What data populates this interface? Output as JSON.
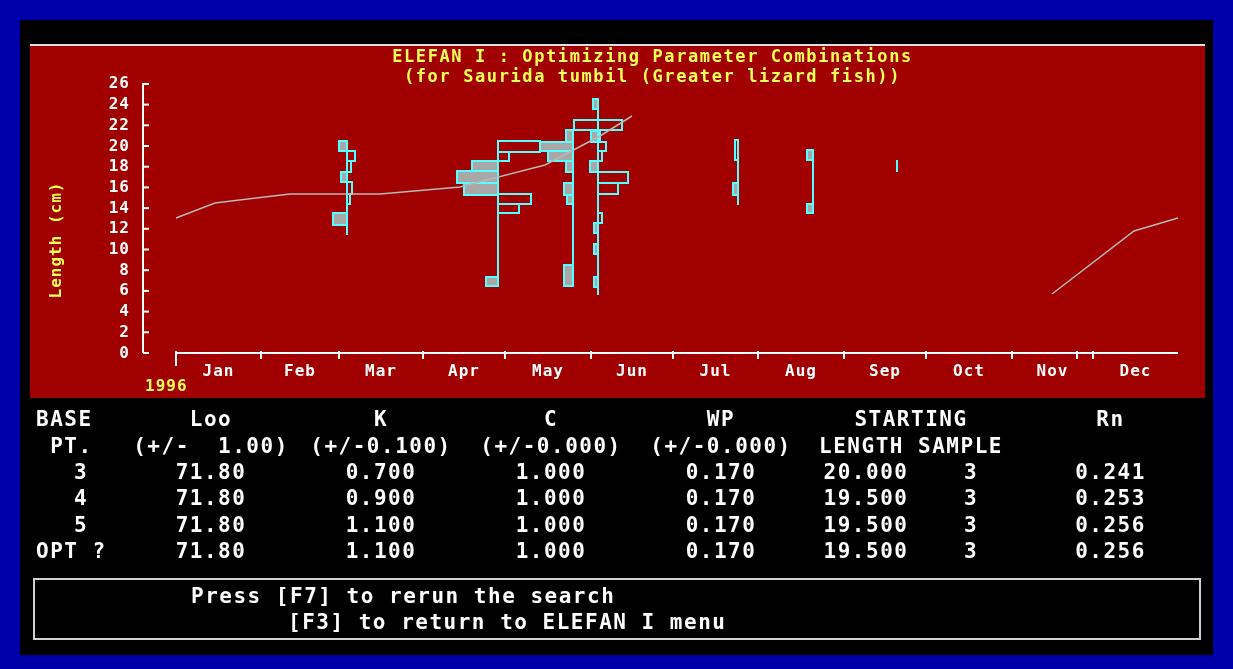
{
  "chart": {
    "title": "ELEFAN I : Optimizing Parameter Combinations",
    "subtitle": "(for Saurida tumbil (Greater lizard fish))",
    "ylabel": "Length (cm)",
    "yticks": [
      "26",
      "24",
      "22",
      "20",
      "18",
      "16",
      "14",
      "12",
      "10",
      "8",
      "6",
      "4",
      "2",
      "0"
    ],
    "months": [
      "Jan",
      "Feb",
      "Mar",
      "Apr",
      "May",
      "Jun",
      "Jul",
      "Aug",
      "Sep",
      "Oct",
      "Nov",
      "Dec"
    ],
    "year": "1996"
  },
  "table": {
    "header": [
      "BASE",
      "Loo",
      "K",
      "C",
      "WP",
      "STARTING",
      "Rn"
    ],
    "subheader": [
      "PT.",
      "(+/-  1.00)",
      "(+/-0.100)",
      "(+/-0.000)",
      "(+/-0.000)",
      "LENGTH SAMPLE"
    ],
    "rows": [
      {
        "base": "3",
        "loo": "71.80",
        "k": "0.700",
        "c": "1.000",
        "wp": "0.170",
        "length": "20.000",
        "sample": "3",
        "rn": "0.241"
      },
      {
        "base": "4",
        "loo": "71.80",
        "k": "0.900",
        "c": "1.000",
        "wp": "0.170",
        "length": "19.500",
        "sample": "3",
        "rn": "0.253"
      },
      {
        "base": "5",
        "loo": "71.80",
        "k": "1.100",
        "c": "1.000",
        "wp": "0.170",
        "length": "19.500",
        "sample": "3",
        "rn": "0.256"
      },
      {
        "base": "OPT ?",
        "loo": "71.80",
        "k": "1.100",
        "c": "1.000",
        "wp": "0.170",
        "length": "19.500",
        "sample": "3",
        "rn": "0.256"
      }
    ]
  },
  "footer": {
    "lines": [
      "Press [F7] to rerun the search",
      "[F3] to return to ELEFAN I menu"
    ]
  }
}
